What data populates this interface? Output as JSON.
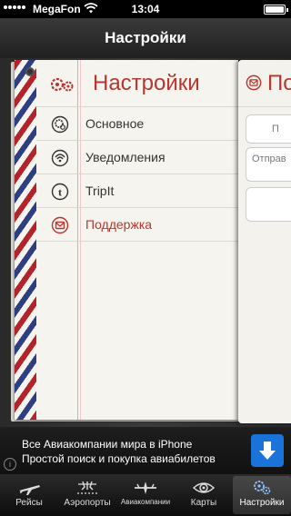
{
  "status_bar": {
    "carrier": "MegaFon",
    "time": "13:04"
  },
  "nav_bar": {
    "title": "Настройки"
  },
  "settings_page": {
    "title": "Настройки",
    "items": [
      {
        "label": "Основное",
        "icon": "settings-circle-icon",
        "active": false
      },
      {
        "label": "Уведомления",
        "icon": "broadcast-icon",
        "active": false
      },
      {
        "label": "TripIt",
        "icon": "tripit-icon",
        "active": false
      },
      {
        "label": "Поддержка",
        "icon": "mail-icon",
        "active": true
      }
    ]
  },
  "support_page": {
    "title": "По",
    "field1": "П",
    "field2": "Отправ"
  },
  "ad_banner": {
    "line1": "Все Авиакомпании мира в iPhone",
    "line2": "Простой поиск и покупка авиабилетов",
    "info_label": "i",
    "download_icon": "download-arrow-icon"
  },
  "tab_bar": {
    "tabs": [
      {
        "label": "Рейсы",
        "icon": "plane-icon",
        "active": false
      },
      {
        "label": "Аэропорты",
        "icon": "airport-icon",
        "active": false
      },
      {
        "label": "Авиакомпании",
        "icon": "airline-icon",
        "active": false
      },
      {
        "label": "Карты",
        "icon": "map-eye-icon",
        "active": false
      },
      {
        "label": "Настройки",
        "icon": "gears-icon",
        "active": true
      }
    ]
  },
  "colors": {
    "accent_red": "#b9352f",
    "stripe_red": "#b3232a",
    "stripe_blue": "#2d3e82",
    "paper": "#f6f4ee",
    "download_blue": "#1a73d9"
  }
}
